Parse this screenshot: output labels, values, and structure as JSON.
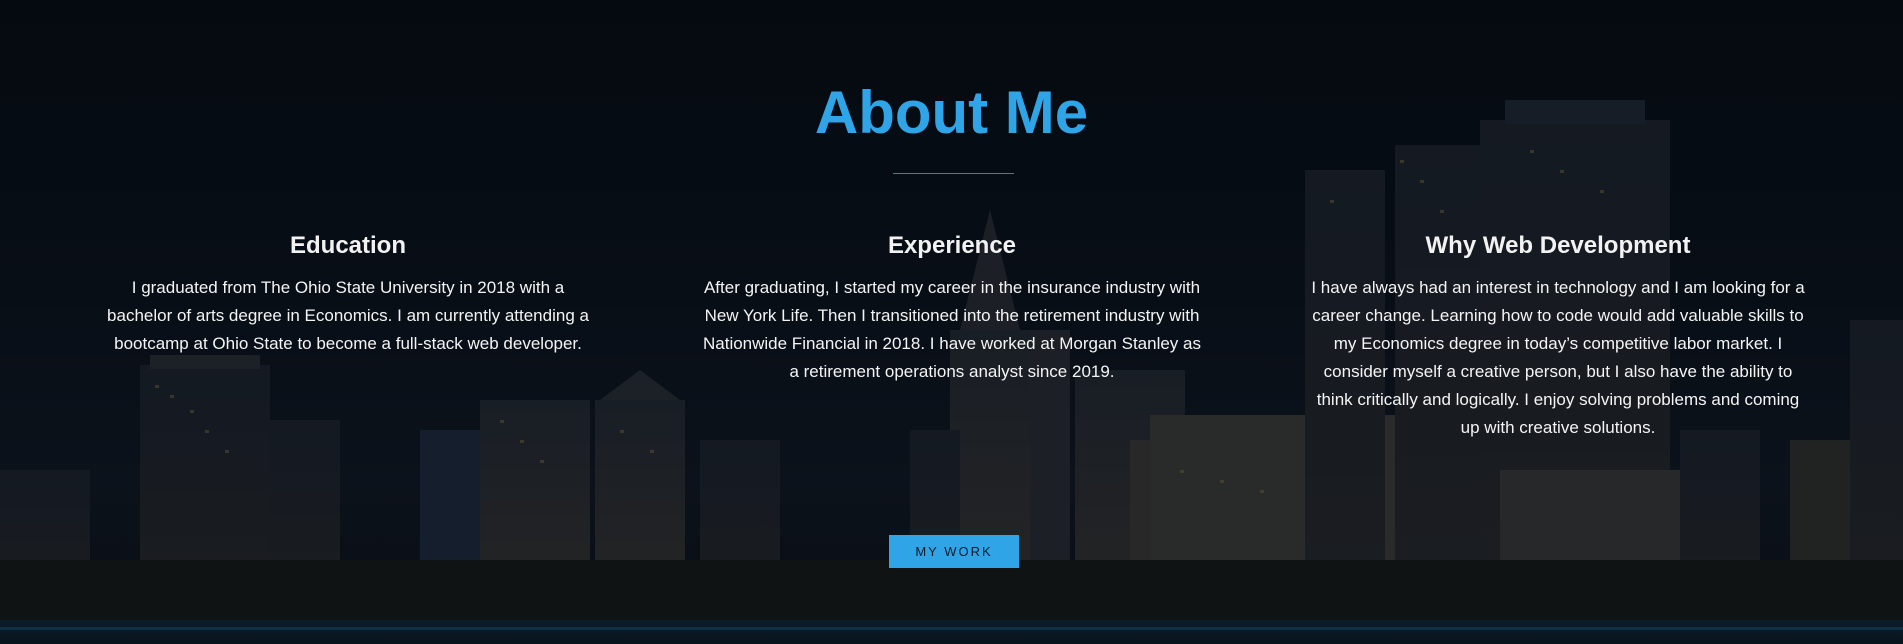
{
  "about": {
    "title": "About Me",
    "columns": [
      {
        "heading": "Education",
        "text": "I graduated from The Ohio State University in 2018 with a bachelor of arts degree in Economics. I am currently attending a bootcamp at Ohio State to become a full-stack web developer."
      },
      {
        "heading": "Experience",
        "text": "After graduating, I started my career in the insurance industry with New York Life. Then I transitioned into the retirement industry with Nationwide Financial in 2018. I have worked at Morgan Stanley as a retirement operations analyst since 2019."
      },
      {
        "heading": "Why Web Development",
        "text": "I have always had an interest in technology and I am looking for a career change. Learning how to code would add valuable skills to my Economics degree in today’s competitive labor market. I consider myself a creative person, but I also have the ability to think critically and logically. I enjoy solving problems and coming up with creative solutions."
      }
    ],
    "button_label": "MY WORK"
  },
  "colors": {
    "accent": "#2fa4e7",
    "background": "#070b12",
    "text": "#ffffff"
  }
}
